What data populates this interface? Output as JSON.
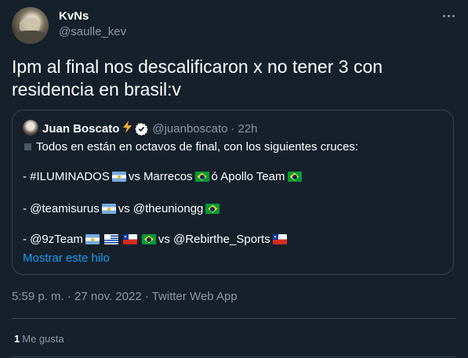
{
  "author": {
    "name": "KvNs",
    "handle": "@saulle_kev"
  },
  "tweet": {
    "text": "Ipm al final nos descalificaron x no tener 3 con residencia en brasil:v",
    "timestamp": "5:59 p. m. · 27 nov. 2022 · Twitter Web App"
  },
  "quote": {
    "name": "Juan Boscato",
    "handle": "@juanboscato",
    "separator": "·",
    "time": "22h",
    "intro": "Todos en están en octavos de final, con los siguientes cruces:",
    "line1": {
      "a": "- #ILUMINADOS",
      "b": "vs Marrecos",
      "c": "ó Apollo Team"
    },
    "line2": {
      "a": "- @teamisurus",
      "b": "vs @theuniongg"
    },
    "line3": {
      "a": "- @9zTeam",
      "b": "vs @Rebirthe_Sports"
    },
    "show_thread": "Mostrar este hilo"
  },
  "engagement": {
    "likes_count": "1",
    "likes_label": "Me gusta"
  },
  "icons": {
    "more": "more-dots-icon",
    "verified": "verified-badge-icon",
    "bolt": "lightning-bolt-icon",
    "flags": [
      "argentina-flag",
      "brazil-flag",
      "uruguay-flag",
      "chile-flag"
    ]
  },
  "colors": {
    "background": "#15202b",
    "text": "#ffffff",
    "secondary": "#8b98a5",
    "link": "#1d9bf0",
    "border": "#38444d"
  }
}
